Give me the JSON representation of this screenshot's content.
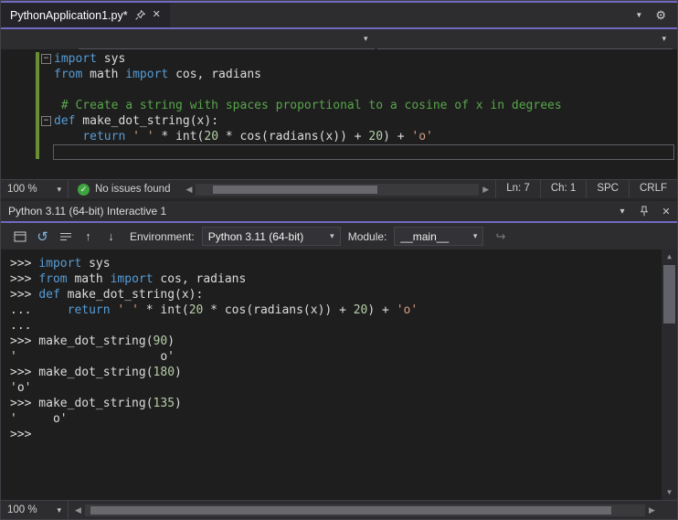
{
  "colors": {
    "accent_purple": "#6f6ac1",
    "keyword_blue": "#569cd6",
    "string_orange": "#d69d85",
    "comment_green": "#57a64a",
    "number_green": "#b5cea8",
    "plain_text": "#dcdcdc",
    "change_bar_green": "#688f34",
    "check_green": "#3fa33f",
    "editor_bg": "#1e1e1e",
    "chrome_bg": "#2d2d30"
  },
  "tab": {
    "title": "PythonApplication1.py*"
  },
  "editor": {
    "lines": [
      {
        "fold": true,
        "tokens": [
          [
            "kw",
            "import"
          ],
          [
            "pln",
            " sys"
          ]
        ]
      },
      {
        "tokens": [
          [
            "kw",
            "from"
          ],
          [
            "pln",
            " math "
          ],
          [
            "kw",
            "import"
          ],
          [
            "pln",
            " cos, radians"
          ]
        ]
      },
      {
        "tokens": []
      },
      {
        "tokens": [
          [
            "com",
            " # Create a string with spaces proportional to a cosine of x in degrees"
          ]
        ]
      },
      {
        "fold": true,
        "tokens": [
          [
            "kw",
            "def"
          ],
          [
            "pln",
            " make_dot_string(x):"
          ]
        ]
      },
      {
        "tokens": [
          [
            "pln",
            "    "
          ],
          [
            "kw",
            "return"
          ],
          [
            "pln",
            " "
          ],
          [
            "str",
            "' '"
          ],
          [
            "pln",
            " * int("
          ],
          [
            "num",
            "20"
          ],
          [
            "pln",
            " * cos(radians(x)) + "
          ],
          [
            "num",
            "20"
          ],
          [
            "pln",
            ") + "
          ],
          [
            "str",
            "'o'"
          ]
        ]
      },
      {
        "caret": true,
        "tokens": []
      }
    ]
  },
  "editor_status": {
    "zoom": "100 %",
    "issues": "No issues found",
    "line": "Ln: 7",
    "column": "Ch: 1",
    "spaces": "SPC",
    "line_ending": "CRLF"
  },
  "interactive": {
    "title": "Python 3.11 (64-bit) Interactive 1",
    "environment_label": "Environment:",
    "environment_value": "Python 3.11 (64-bit)",
    "module_label": "Module:",
    "module_value": "__main__",
    "zoom": "100 %",
    "lines": [
      {
        "tokens": [
          [
            "pln",
            ">>> "
          ],
          [
            "kw",
            "import"
          ],
          [
            "pln",
            " sys"
          ]
        ]
      },
      {
        "tokens": [
          [
            "pln",
            ">>> "
          ],
          [
            "kw",
            "from"
          ],
          [
            "pln",
            " math "
          ],
          [
            "kw",
            "import"
          ],
          [
            "pln",
            " cos, radians"
          ]
        ]
      },
      {
        "tokens": [
          [
            "pln",
            ">>> "
          ],
          [
            "kw",
            "def"
          ],
          [
            "pln",
            " make_dot_string(x):"
          ]
        ]
      },
      {
        "tokens": [
          [
            "pln",
            "...     "
          ],
          [
            "kw",
            "return"
          ],
          [
            "pln",
            " "
          ],
          [
            "str",
            "' '"
          ],
          [
            "pln",
            " * int("
          ],
          [
            "num",
            "20"
          ],
          [
            "pln",
            " * cos(radians(x)) + "
          ],
          [
            "num",
            "20"
          ],
          [
            "pln",
            ") + "
          ],
          [
            "str",
            "'o'"
          ]
        ]
      },
      {
        "tokens": [
          [
            "pln",
            "..."
          ]
        ]
      },
      {
        "tokens": [
          [
            "pln",
            ">>> make_dot_string("
          ],
          [
            "num",
            "90"
          ],
          [
            "pln",
            ")"
          ]
        ]
      },
      {
        "tokens": [
          [
            "pln",
            "'                    o'"
          ]
        ]
      },
      {
        "tokens": [
          [
            "pln",
            ">>> make_dot_string("
          ],
          [
            "num",
            "180"
          ],
          [
            "pln",
            ")"
          ]
        ]
      },
      {
        "tokens": [
          [
            "pln",
            "'o'"
          ]
        ]
      },
      {
        "tokens": [
          [
            "pln",
            ">>> make_dot_string("
          ],
          [
            "num",
            "135"
          ],
          [
            "pln",
            ")"
          ]
        ]
      },
      {
        "tokens": [
          [
            "pln",
            "'     o'"
          ]
        ]
      },
      {
        "tokens": [
          [
            "pln",
            ">>> "
          ]
        ]
      }
    ]
  }
}
